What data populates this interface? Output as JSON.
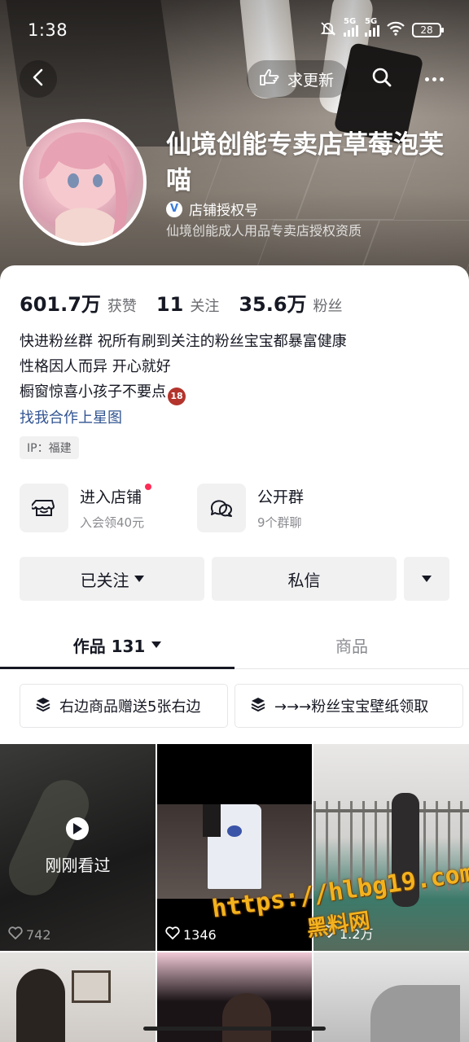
{
  "status_bar": {
    "time": "1:38",
    "signal1": "5G",
    "signal2": "5G",
    "battery": "28"
  },
  "topbar": {
    "update_label": "求更新"
  },
  "profile": {
    "name": "仙境创能专卖店草莓泡芙喵",
    "verified_label": "店铺授权号",
    "qualification": "仙境创能成人用品专卖店授权资质"
  },
  "stats": [
    {
      "value": "601.7万",
      "label": "获赞"
    },
    {
      "value": "11",
      "label": "关注"
    },
    {
      "value": "35.6万",
      "label": "粉丝"
    }
  ],
  "bio": {
    "lines": [
      "快进粉丝群 祝所有刷到关注的粉丝宝宝都暴富健康",
      "性格因人而异 开心就好",
      "橱窗惊喜小孩子不要点"
    ],
    "age_badge": "18",
    "link": "找我合作上星图"
  },
  "ip": "IP：福建",
  "shortcuts": {
    "shop": {
      "title": "进入店铺",
      "subtitle": "入会领40元"
    },
    "group": {
      "title": "公开群",
      "subtitle": "9个群聊"
    }
  },
  "actions": {
    "follow": "已关注",
    "message": "私信"
  },
  "tabs": {
    "works": "作品 131",
    "goods": "商品"
  },
  "collections": [
    "右边商品赠送5张右边",
    "→→→粉丝宝宝壁纸领取"
  ],
  "videos": [
    {
      "likes": "742",
      "overlay": "刚刚看过"
    },
    {
      "likes": "1346"
    },
    {
      "likes": "1.2万"
    }
  ],
  "watermark": {
    "url": "https://hlbg19.com",
    "brand": "黑料网"
  },
  "colors": {
    "accent_red": "#fe2c55",
    "link_blue": "#315492"
  }
}
